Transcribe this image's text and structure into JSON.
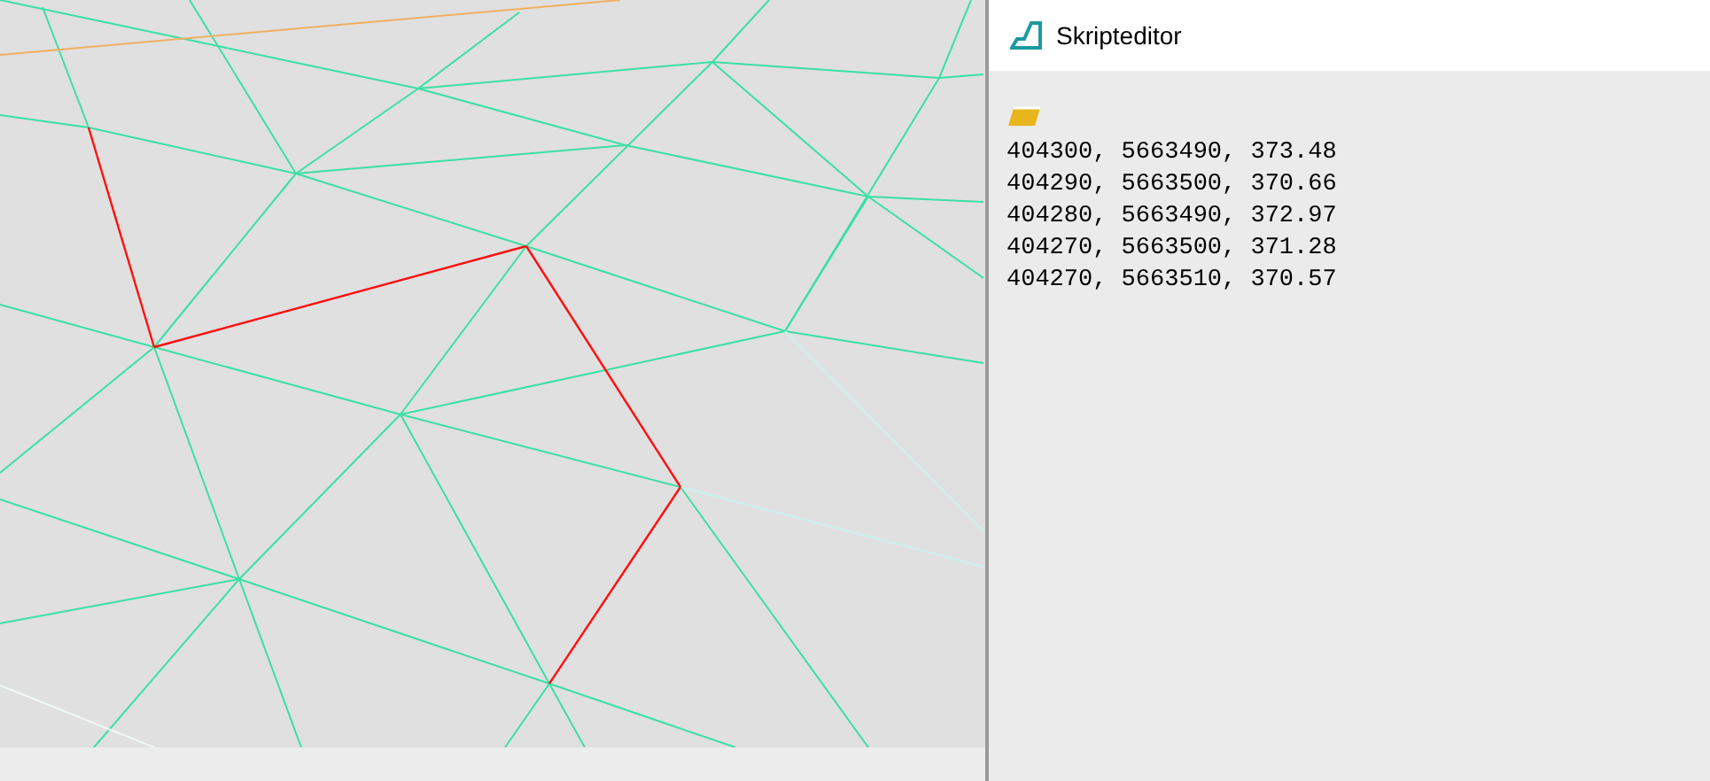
{
  "editor": {
    "title": "Skripteditor",
    "lines": [
      "404300, 5663490, 373.48",
      "404290, 5663500, 370.66",
      "404280, 5663490, 372.97",
      "404270, 5663500, 371.28",
      "404270, 5663510, 370.57"
    ]
  }
}
